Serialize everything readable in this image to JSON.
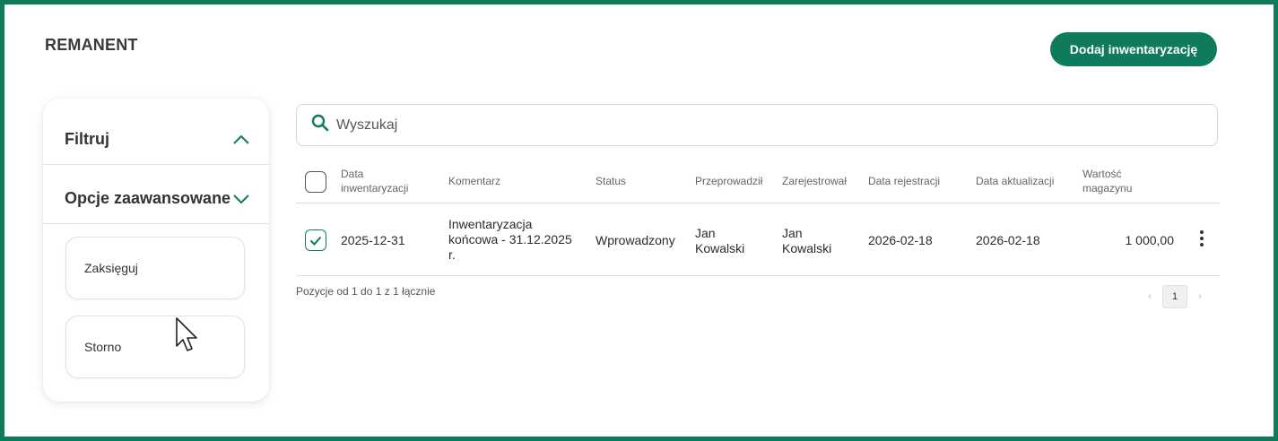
{
  "page": {
    "title": "REMANENT",
    "add_button": "Dodaj inwentaryzację"
  },
  "filter_panel": {
    "filter_label": "Filtruj",
    "advanced_label": "Opcje zaawansowane",
    "actions": [
      "Zaksięguj",
      "Storno"
    ]
  },
  "search": {
    "placeholder": "Wyszukaj",
    "value": ""
  },
  "table": {
    "headers": {
      "date_inv_1": "Data",
      "date_inv_2": "inwentaryzacji",
      "comment": "Komentarz",
      "status": "Status",
      "conducted": "Przeprowadził",
      "registered": "Zarejestrował",
      "reg_date": "Data rejestracji",
      "upd_date": "Data aktualizacji",
      "value_1": "Wartość",
      "value_2": "magazynu"
    },
    "rows": [
      {
        "checked": true,
        "date": "2025-12-31",
        "comment_1": "Inwentaryzacja",
        "comment_2": "końcowa - 31.12.2025",
        "comment_3": "r.",
        "status": "Wprowadzony",
        "conducted_1": "Jan",
        "conducted_2": "Kowalski",
        "registered_1": "Jan",
        "registered_2": "Kowalski",
        "reg_date": "2026-02-18",
        "upd_date": "2026-02-18",
        "value": "1 000,00"
      }
    ]
  },
  "pagination": {
    "summary": "Pozycje od 1 do 1 z 1 łącznie",
    "prev": "‹",
    "current": "1",
    "next": "›"
  },
  "colors": {
    "accent": "#0f7a5c"
  }
}
